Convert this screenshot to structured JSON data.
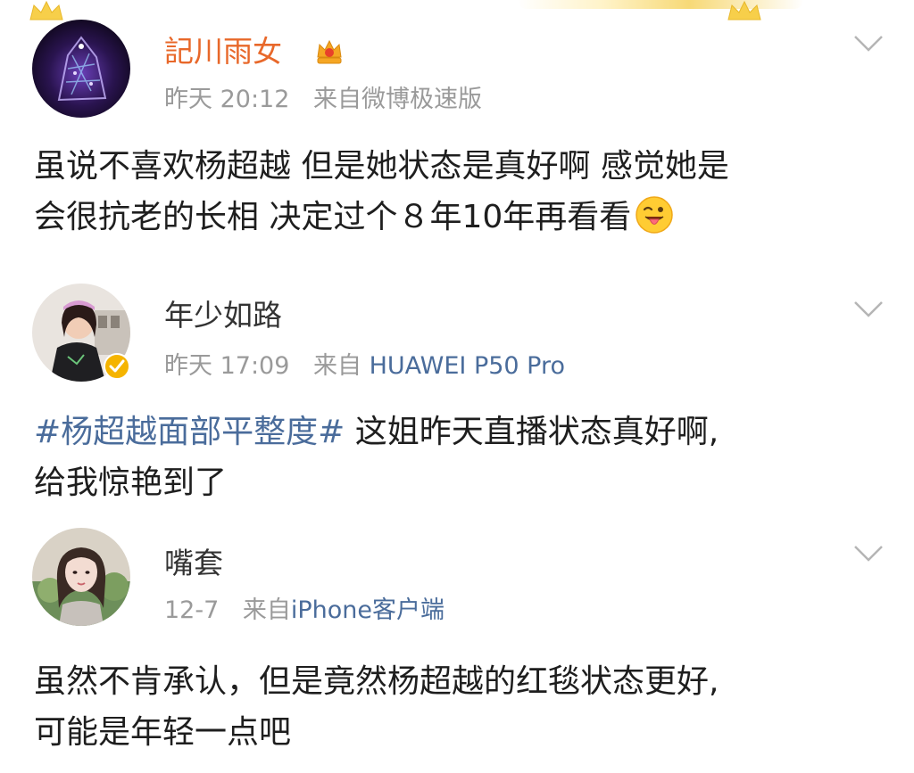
{
  "posts": [
    {
      "username": "記川雨女",
      "time": "昨天 20:12",
      "source_prefix": "来自",
      "source": "微博极速版",
      "content_line1": "虽说不喜欢杨超越 但是她状态是真好啊 感觉她是",
      "content_line2": "会很抗老的长相 决定过个８年10年再看看",
      "emoji": "tongue-wink-emoji"
    },
    {
      "username": "年少如路",
      "time": "昨天 17:09",
      "source_prefix": "来自",
      "source": "HUAWEI P50 Pro",
      "topic": "#杨超越面部平整度#",
      "content_line1": " 这姐昨天直播状态真好啊,",
      "content_line2": "给我惊艳到了"
    },
    {
      "username": "嘴套",
      "time": "12-7",
      "source_prefix": "来自",
      "source": "iPhone客户端",
      "content_line1": "虽然不肯承认，但是竟然杨超越的红毯状态更好,",
      "content_line2": "可能是年轻一点吧"
    }
  ],
  "colors": {
    "vip_name": "#e8682a",
    "link": "#4a6c9b",
    "meta": "#9a9a9a",
    "text": "#1e1e1e",
    "verified": "#f5b400"
  },
  "icons": [
    "crown-icon",
    "vip-crown-icon",
    "chevron-down-icon",
    "verified-badge-icon",
    "tongue-wink-emoji"
  ]
}
